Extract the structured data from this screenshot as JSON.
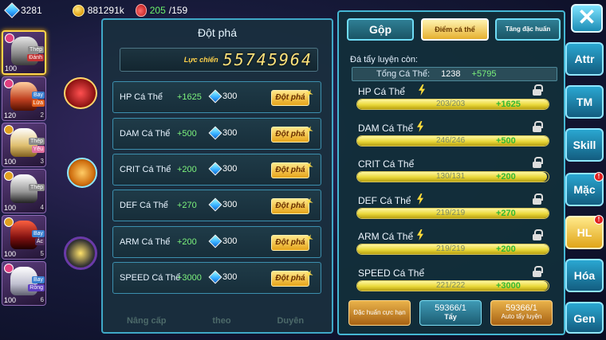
{
  "topbar": {
    "gems": "3281",
    "gold": "881291k",
    "potion_current": "205",
    "potion_max": "/159"
  },
  "team": [
    {
      "level": "100",
      "tag1": "Thép",
      "tag2": "Đánh",
      "slot": "1"
    },
    {
      "level": "120",
      "tag1": "Bay",
      "tag2": "Lửa",
      "slot": "2"
    },
    {
      "level": "100",
      "tag1": "Thép",
      "tag2": "Yêu",
      "slot": "3"
    },
    {
      "level": "100",
      "tag1": "Thép",
      "tag2": "",
      "slot": "4"
    },
    {
      "level": "100",
      "tag1": "Bay",
      "tag2": "Ác",
      "slot": "5"
    },
    {
      "level": "100",
      "tag1": "Bay",
      "tag2": "Rồng",
      "slot": "6"
    }
  ],
  "left_panel": {
    "title": "Đột phá",
    "power_label": "Lực chiến",
    "power_value": "55745964",
    "breakthrough_label": "Đột phá",
    "rows": [
      {
        "name": "HP Cá Thể",
        "bonus": "+1625",
        "cost": "300"
      },
      {
        "name": "DAM Cá Thể",
        "bonus": "+500",
        "cost": "300"
      },
      {
        "name": "CRIT Cá Thể",
        "bonus": "+200",
        "cost": "300"
      },
      {
        "name": "DEF Cá Thể",
        "bonus": "+270",
        "cost": "300"
      },
      {
        "name": "ARM Cá Thể",
        "bonus": "+200",
        "cost": "300"
      },
      {
        "name": "SPEED Cá Thể",
        "bonus": "+3000",
        "cost": "300"
      }
    ],
    "bottom_tabs": [
      "Nâng cấp",
      "theo",
      "Duyên"
    ]
  },
  "right_panel": {
    "tabs": [
      "Gộp",
      "Điểm cá thể",
      "Tăng đặc huấn"
    ],
    "remaining_label": "Đá tẩy luyện còn:",
    "total_label": "Tổng Cá Thể:",
    "total_value": "1238",
    "total_bonus": "+5795",
    "stats": [
      {
        "name": "HP Cá Thể",
        "value": "203/203",
        "bonus": "+1625",
        "fill": 1.0
      },
      {
        "name": "DAM Cá Thể",
        "value": "246/246",
        "bonus": "+500",
        "fill": 1.0
      },
      {
        "name": "CRIT Cá Thể",
        "value": "130/131",
        "bonus": "+200",
        "fill": 0.99
      },
      {
        "name": "DEF Cá Thể",
        "value": "219/219",
        "bonus": "+270",
        "fill": 1.0
      },
      {
        "name": "ARM Cá Thể",
        "value": "219/219",
        "bonus": "+200",
        "fill": 1.0
      },
      {
        "name": "SPEED Cá Thể",
        "value": "221/222",
        "bonus": "+3000",
        "fill": 0.995
      }
    ],
    "buttons": {
      "special": "Đặc huấn cực hạn",
      "wash_count": "59366/1",
      "wash_label": "Tẩy",
      "auto_count": "59366/1",
      "auto_label": "Auto tẩy luyện"
    }
  },
  "side_menu": [
    "Attr",
    "TM",
    "Skill",
    "Mặc",
    "HL",
    "Hóa",
    "Gen"
  ],
  "side_badges": {
    "Mặc": "!",
    "HL": "!"
  },
  "colors": {
    "accent": "#45b7d4",
    "gold": "#e6a41a",
    "bonus_green": "#7cf27c"
  }
}
